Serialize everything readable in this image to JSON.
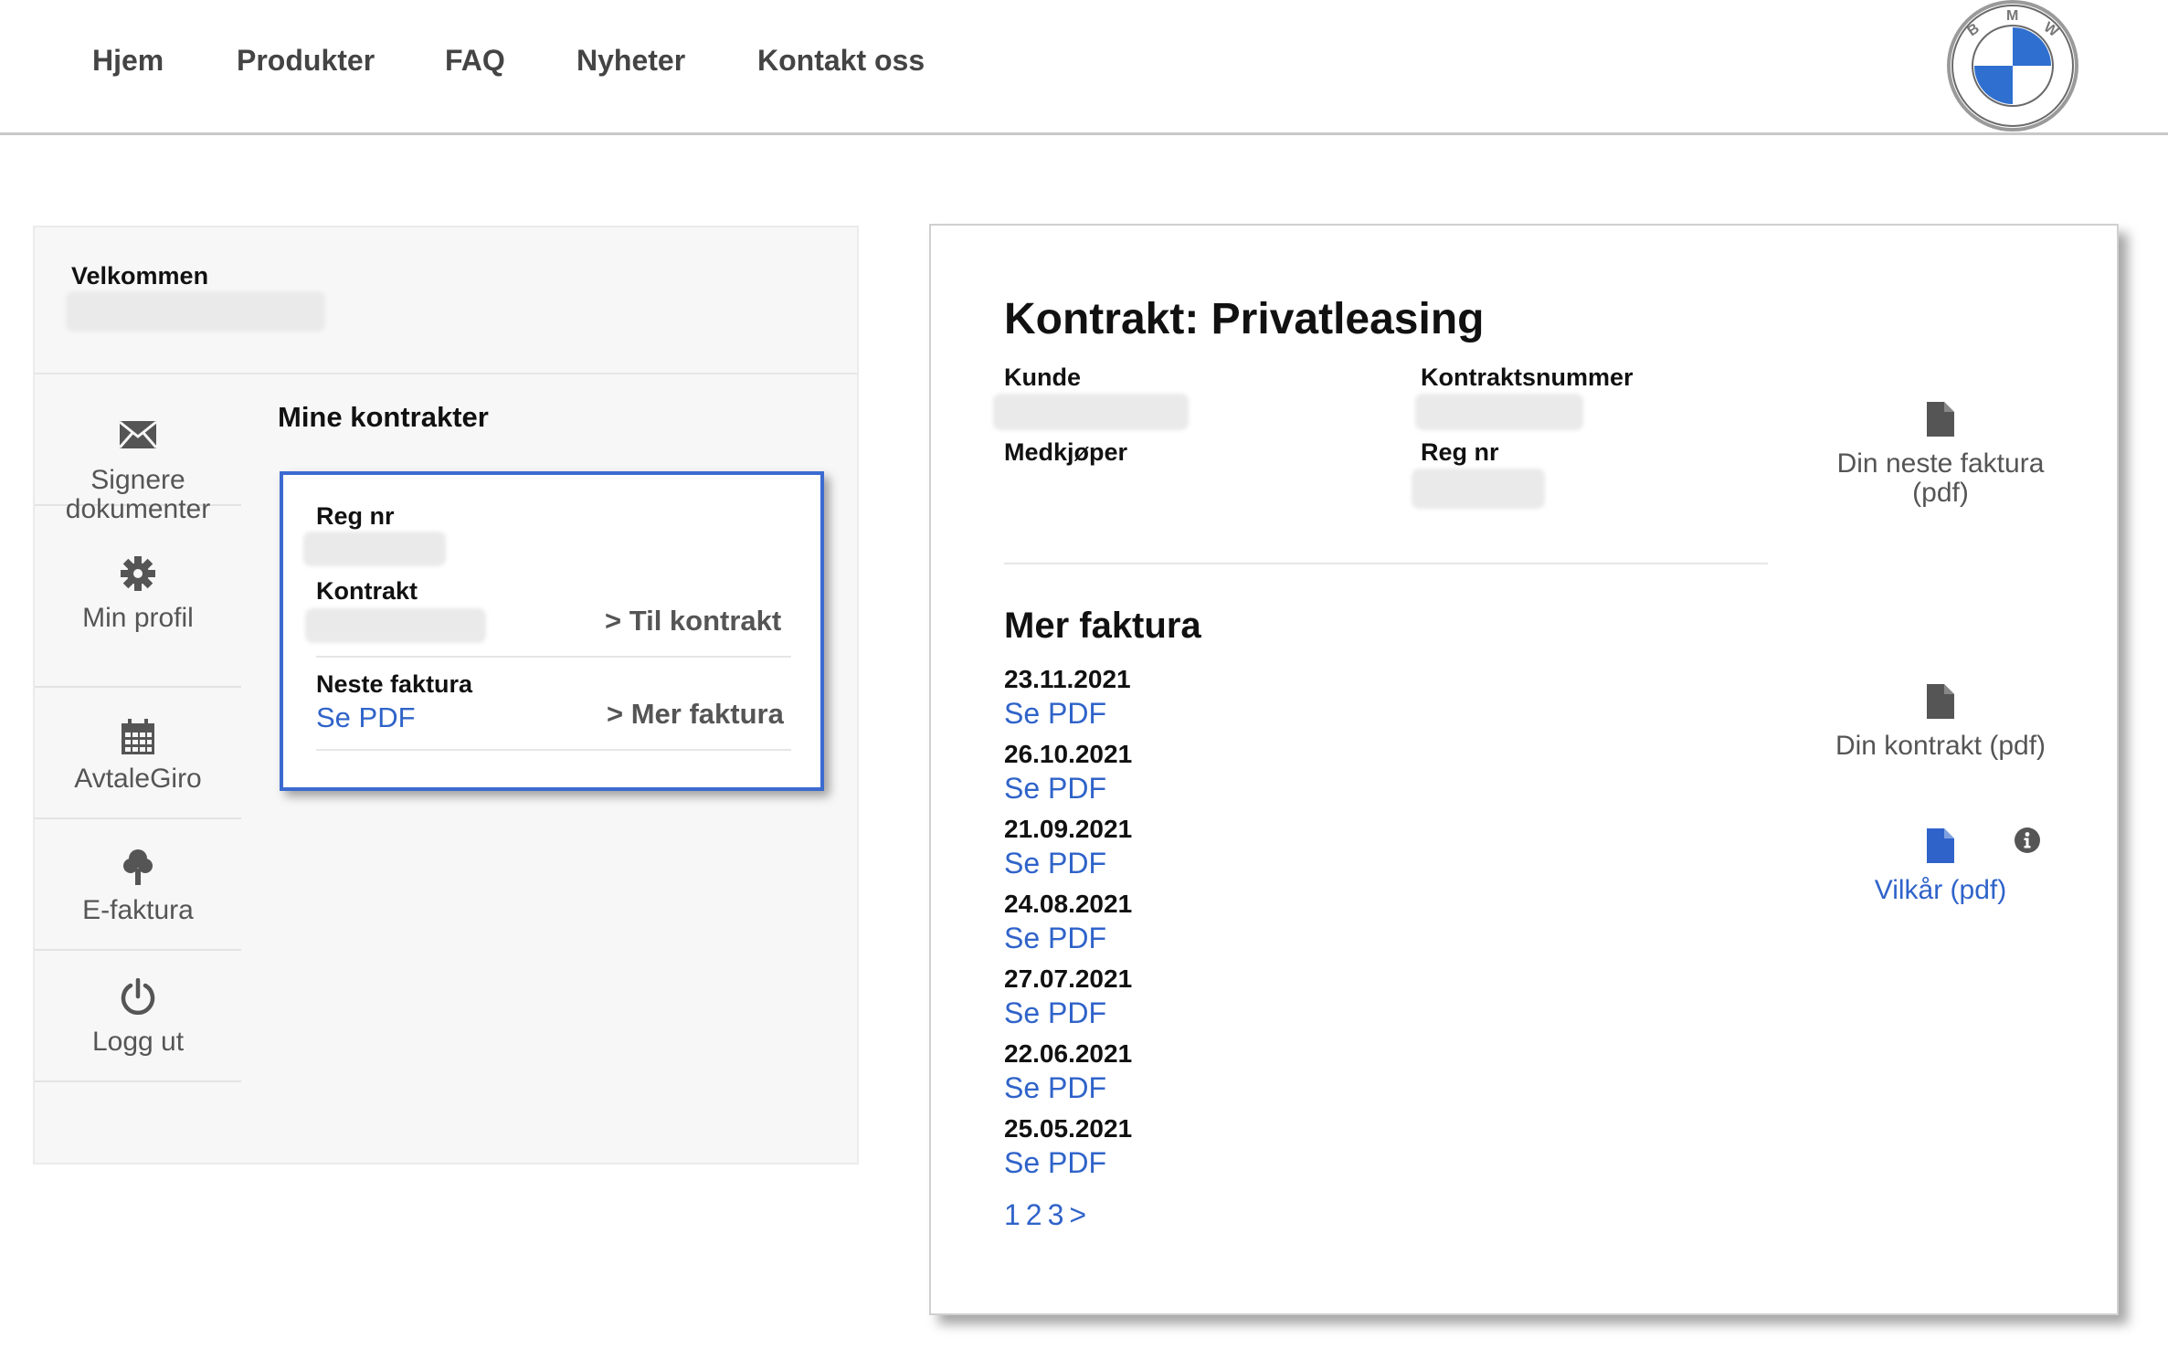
{
  "nav": {
    "items": [
      "Hjem",
      "Produkter",
      "FAQ",
      "Nyheter",
      "Kontakt oss"
    ],
    "logo_icon": "bmw-logo-icon"
  },
  "sidebar": {
    "welcome": "Velkommen",
    "items": [
      {
        "label": "Signere dokumenter",
        "icon": "envelope-icon"
      },
      {
        "label": "Min profil",
        "icon": "gear-icon"
      },
      {
        "label": "AvtaleGiro",
        "icon": "calendar-icon"
      },
      {
        "label": "E-faktura",
        "icon": "tree-icon"
      },
      {
        "label": "Logg ut",
        "icon": "power-icon"
      }
    ]
  },
  "contracts": {
    "title": "Mine kontrakter",
    "card": {
      "reg_label": "Reg nr",
      "contract_label": "Kontrakt",
      "to_contract_link": "> Til kontrakt",
      "next_invoice_label": "Neste faktura",
      "see_pdf": "Se PDF",
      "more_invoices_link": "> Mer faktura"
    }
  },
  "contract_detail": {
    "heading": "Kontrakt: Privatleasing",
    "customer_label": "Kunde",
    "contract_number_label": "Kontraktsnummer",
    "co_buyer_label": "Medkjøper",
    "reg_label": "Reg nr",
    "more_invoices_heading": "Mer faktura",
    "invoices": [
      {
        "date": "23.11.2021",
        "link": "Se PDF"
      },
      {
        "date": "26.10.2021",
        "link": "Se PDF"
      },
      {
        "date": "21.09.2021",
        "link": "Se PDF"
      },
      {
        "date": "24.08.2021",
        "link": "Se PDF"
      },
      {
        "date": "27.07.2021",
        "link": "Se PDF"
      },
      {
        "date": "22.06.2021",
        "link": "Se PDF"
      },
      {
        "date": "25.05.2021",
        "link": "Se PDF"
      }
    ],
    "pagination": [
      "1",
      "2",
      "3",
      ">"
    ],
    "documents": {
      "next_invoice": "Din neste faktura (pdf)",
      "contract": "Din kontrakt (pdf)",
      "terms": "Vilkår (pdf)"
    }
  },
  "colors": {
    "link_blue": "#2f63c9",
    "card_border": "#3b6bd1",
    "text_grey": "#555555"
  }
}
